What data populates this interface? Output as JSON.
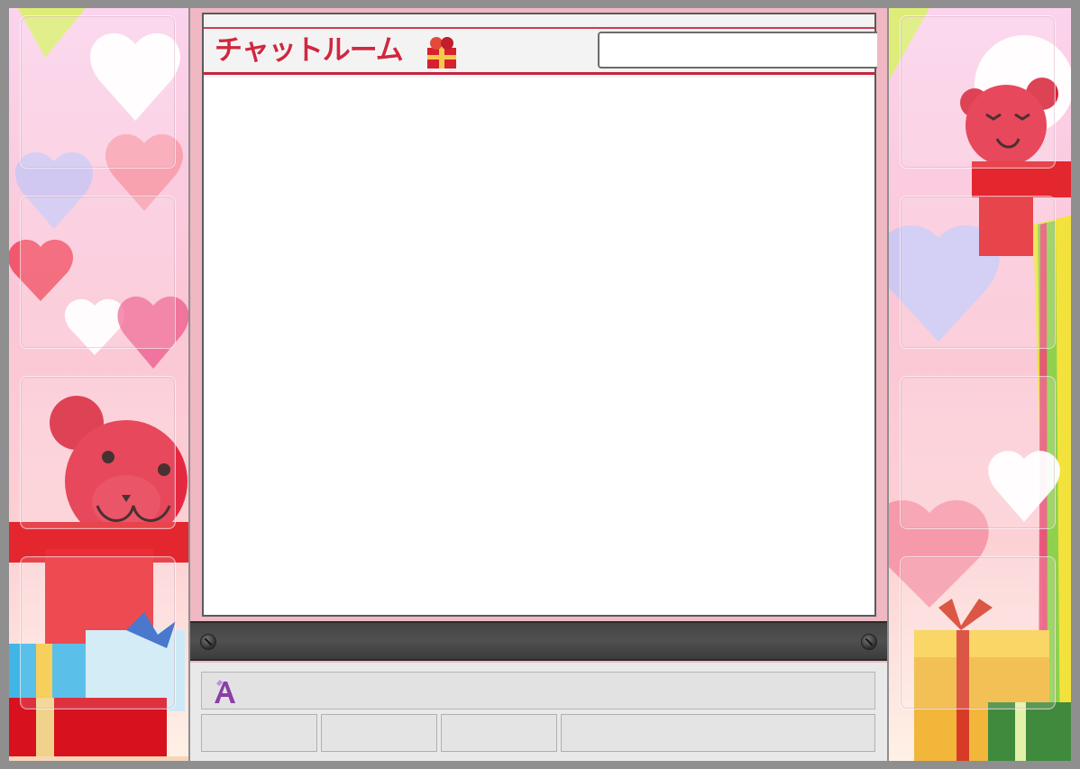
{
  "header": {
    "title": "チャットルーム",
    "room_input_value": "",
    "room_input_placeholder": ""
  },
  "chat": {
    "messages": []
  },
  "composer": {
    "message_value": "",
    "message_placeholder": "",
    "buttons": [
      {
        "label": ""
      },
      {
        "label": ""
      },
      {
        "label": ""
      },
      {
        "label": ""
      }
    ]
  },
  "icons": {
    "gift": "gift-icon",
    "font": "font-style-icon",
    "screw": "screw-icon"
  },
  "colors": {
    "accent": "#d0283f",
    "side_bg": "#fbc6d6",
    "center_bg": "#efb8c3",
    "bar": "#454545"
  }
}
